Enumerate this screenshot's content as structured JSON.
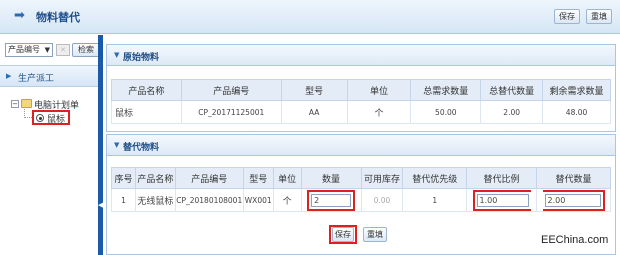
{
  "header": {
    "title": "物料替代",
    "save_label": "保存",
    "reset_label": "重填"
  },
  "sidebar": {
    "field_select": "产品编号",
    "search_label": "检索",
    "nav_title": "生产派工",
    "tree": {
      "root": "电脑计划单",
      "leaf": "鼠标"
    }
  },
  "original": {
    "title": "原始物料",
    "columns": [
      "产品名称",
      "产品编号",
      "型号",
      "单位",
      "总需求数量",
      "总替代数量",
      "剩余需求数量"
    ],
    "row": [
      "鼠标",
      "CP_20171125001",
      "AA",
      "个",
      "50.00",
      "2.00",
      "48.00"
    ]
  },
  "substitute": {
    "title": "替代物料",
    "columns": [
      "序号",
      "产品名称",
      "产品编号",
      "型号",
      "单位",
      "数量",
      "可用库存",
      "替代优先级",
      "替代比例",
      "替代数量"
    ],
    "row": {
      "index": "1",
      "name": "无线鼠标",
      "code": "CP_20180108001",
      "model": "WX001",
      "unit": "个",
      "qty": "2",
      "stock": "0.00",
      "priority": "1",
      "ratio": "1.00",
      "sub_qty": "2.00"
    }
  },
  "footer": {
    "save_label": "保存",
    "reset_label": "重填"
  },
  "watermark": "EEChina.com",
  "colors": {
    "accent": "#1f4f8a",
    "highlight_border": "#e02020",
    "splitter": "#1a5aa6"
  }
}
